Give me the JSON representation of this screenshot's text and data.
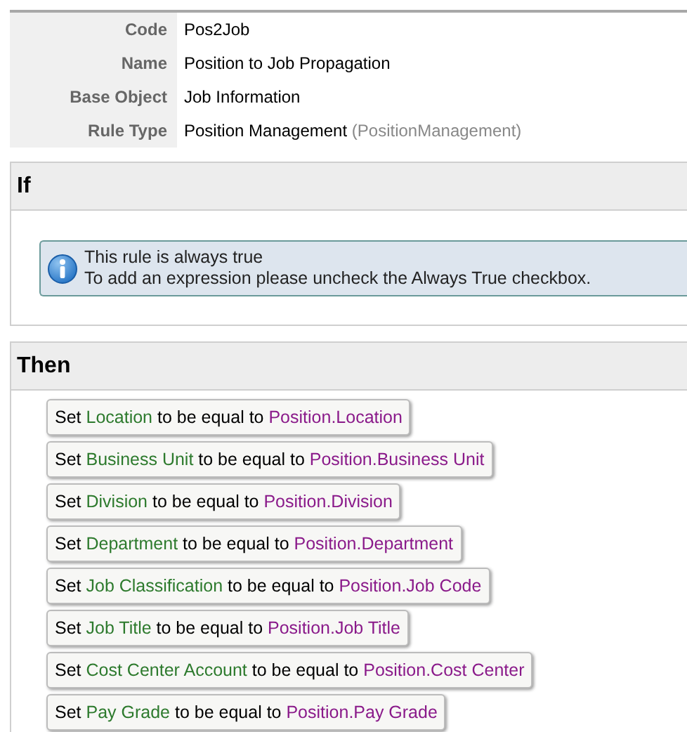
{
  "details": [
    {
      "label": "Code",
      "value": "Pos2Job"
    },
    {
      "label": "Name",
      "value": "Position to Job Propagation"
    },
    {
      "label": "Base Object",
      "value": "Job Information"
    },
    {
      "label": "Rule Type",
      "value": "Position Management",
      "note": "(PositionManagement)"
    }
  ],
  "if_section": {
    "title": "If",
    "info": {
      "lines": [
        "This rule is always true",
        "To add an expression please uncheck the Always True checkbox."
      ]
    }
  },
  "then_section": {
    "title": "Then",
    "actions": [
      {
        "verb": "Set",
        "field": "Location",
        "relation": "to be equal to",
        "source": "Position.Location"
      },
      {
        "verb": "Set",
        "field": "Business Unit",
        "relation": "to be equal to",
        "source": "Position.Business Unit"
      },
      {
        "verb": "Set",
        "field": "Division",
        "relation": "to be equal to",
        "source": "Position.Division"
      },
      {
        "verb": "Set",
        "field": "Department",
        "relation": "to be equal to",
        "source": "Position.Department"
      },
      {
        "verb": "Set",
        "field": "Job Classification",
        "relation": "to be equal to",
        "source": "Position.Job Code"
      },
      {
        "verb": "Set",
        "field": "Job Title",
        "relation": "to be equal to",
        "source": "Position.Job Title"
      },
      {
        "verb": "Set",
        "field": "Cost Center Account",
        "relation": "to be equal to",
        "source": "Position.Cost Center"
      },
      {
        "verb": "Set",
        "field": "Pay Grade",
        "relation": "to be equal to",
        "source": "Position.Pay Grade"
      }
    ]
  }
}
